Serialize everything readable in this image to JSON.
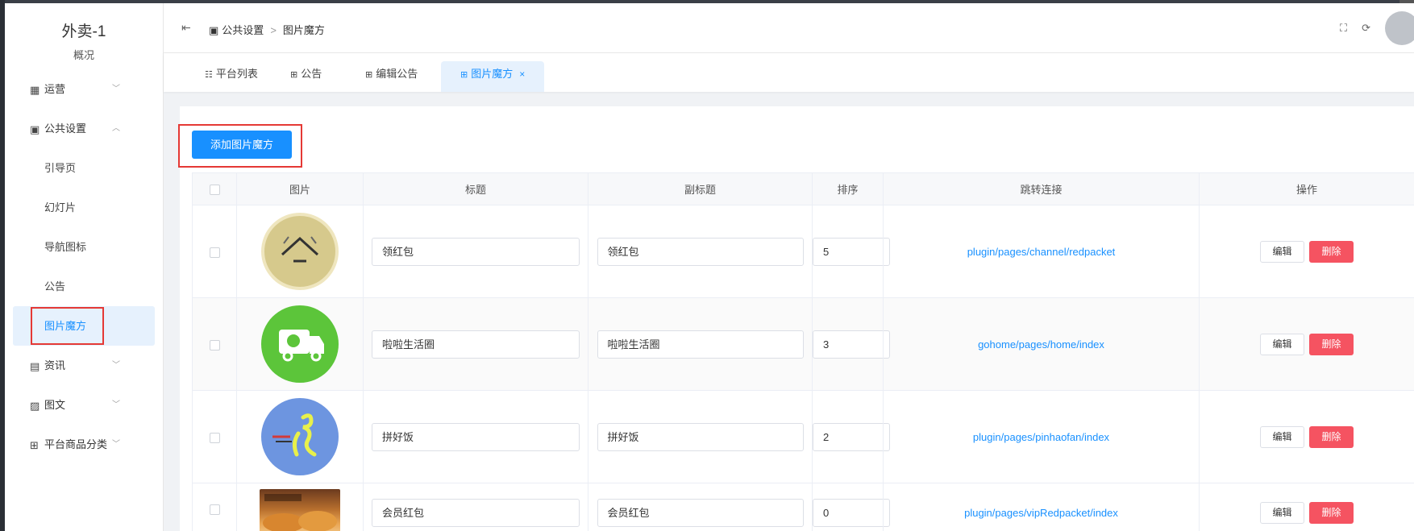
{
  "sidebar": {
    "brand": "外卖-1",
    "brand_sub": "概况",
    "menu": [
      {
        "label": "运营",
        "icon": "dashboard-icon"
      },
      {
        "label": "公共设置",
        "icon": "image-icon"
      },
      {
        "label": "资讯",
        "icon": "document-icon"
      },
      {
        "label": "图文",
        "icon": "picture-text-icon"
      },
      {
        "label": "平台商品分类",
        "icon": "grid-icon"
      }
    ],
    "sub_items": [
      "引导页",
      "幻灯片",
      "导航图标",
      "公告",
      "图片魔方"
    ]
  },
  "header": {
    "breadcrumb": [
      "公共设置",
      "图片魔方"
    ]
  },
  "tabs": [
    {
      "label": "平台列表",
      "icon": "list-icon"
    },
    {
      "label": "公告",
      "icon": "grid-icon"
    },
    {
      "label": "编辑公告",
      "icon": "grid-icon"
    },
    {
      "label": "图片魔方",
      "icon": "grid-icon"
    }
  ],
  "toolbar": {
    "add_label": "添加图片魔方"
  },
  "table": {
    "columns": [
      "图片",
      "标题",
      "副标题",
      "排序",
      "跳转连接",
      "操作"
    ],
    "edit_label": "编辑",
    "delete_label": "删除",
    "rows": [
      {
        "image": "house-badge-icon",
        "title": "领红包",
        "subtitle": "领红包",
        "order": "5",
        "link": "plugin/pages/channel/redpacket"
      },
      {
        "image": "delivery-truck-icon",
        "title": "啦啦生活圈",
        "subtitle": "啦啦生活圈",
        "order": "3",
        "link": "gohome/pages/home/index"
      },
      {
        "image": "running-figure-icon",
        "title": "拼好饭",
        "subtitle": "拼好饭",
        "order": "2",
        "link": "plugin/pages/pinhaofan/index"
      },
      {
        "image": "croissant-photo",
        "title": "会员红包",
        "subtitle": "会员红包",
        "order": "0",
        "link": "plugin/pages/vipRedpacket/index"
      }
    ]
  },
  "colors": {
    "primary": "#1890ff",
    "danger": "#f55361",
    "highlight": "#e53935"
  }
}
